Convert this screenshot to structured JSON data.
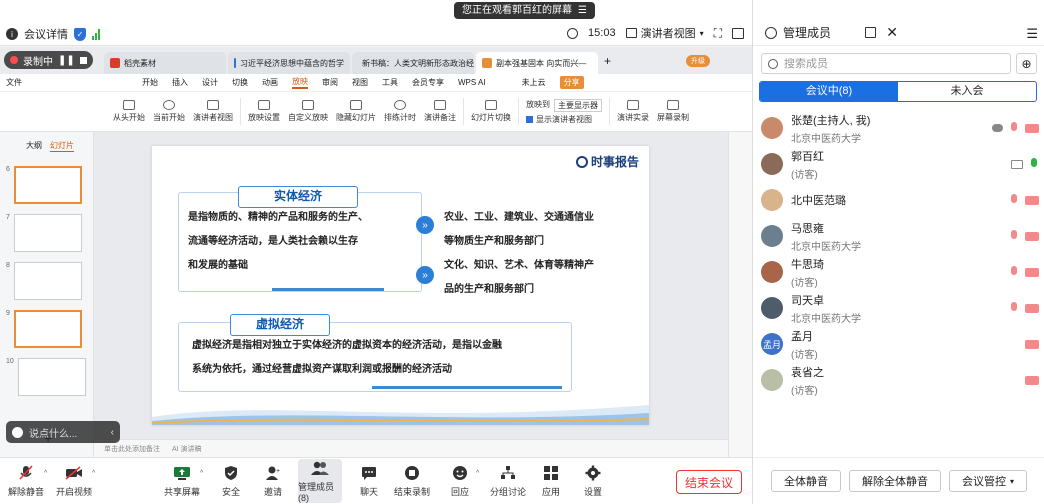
{
  "banner": {
    "text": "您正在观看郭百红的屏幕",
    "icon": "hamburger-icon"
  },
  "topbar": {
    "meeting_details": "会议详情",
    "time": "15:03",
    "view_mode": "演讲者视图"
  },
  "recording": {
    "label": "录制中"
  },
  "browser_tabs": [
    {
      "label": "稻壳素材",
      "color": "#e0392d"
    },
    {
      "label": "习近平经济思想中蕴含的哲学",
      "color": "#2f6fd6"
    },
    {
      "label": "新书稿：人类文明新形态政治经",
      "color": "#2f6fd6"
    },
    {
      "label": "副本强基固本 向实而兴—",
      "color": "#e68e3a"
    }
  ],
  "wps_menu": [
    "文件",
    "开始",
    "插入",
    "设计",
    "切换",
    "动画",
    "放映",
    "审阅",
    "视图",
    "工具",
    "会员专享",
    "WPS AI",
    "未上云",
    "分享"
  ],
  "wps_upgrade": "升级",
  "ribbon": [
    "从头开始",
    "当前开始",
    "演讲者视图",
    "放映设置",
    "自定义放映",
    "隐藏幻灯片",
    "排练计时",
    "演讲备注",
    "幻灯片切换",
    "放映到",
    "主要显示器",
    "显示演讲者视图",
    "演讲实录",
    "屏幕录制"
  ],
  "outline": {
    "tab_outline": "大纲",
    "tab_slides": "幻灯片",
    "slide_numbers": [
      "6",
      "7",
      "8",
      "9",
      "10"
    ],
    "add": "+"
  },
  "comment_box": {
    "placeholder": "说点什么..."
  },
  "slide": {
    "logo": "时事报告",
    "real_title": "实体经济",
    "real_def_lines": [
      "是指物质的、精神的产品和服务的生产、",
      "流通等经济活动，是人类社会赖以生存",
      "和发展的基础"
    ],
    "real_items": [
      [
        "农业、工业、建筑业、交通通信业",
        "等物质生产和服务部门"
      ],
      [
        "文化、知识、艺术、体育等精神产",
        "品的生产和服务部门"
      ]
    ],
    "virtual_title": "虚拟经济",
    "virtual_lines": [
      "虚拟经济是指相对独立于实体经济的虚拟资本的经济活动，是指以金融",
      "系统为依托，通过经营虚拟资产谋取利润或报酬的经济活动"
    ]
  },
  "notes": {
    "placeholder": "单击此处添加备注",
    "ai": "AI 演讲稿"
  },
  "panel": {
    "title": "管理成员",
    "search_placeholder": "搜索成员",
    "tab_in": "会议中(8)",
    "tab_out": "未入会",
    "members": [
      {
        "name": "张楚(主持人, 我)",
        "sub": "北京中医药大学",
        "avatar_color": "#c98a6a",
        "mic": "off",
        "screen": false,
        "extra": "cloud"
      },
      {
        "name": "郭百红",
        "sub": "(访客)",
        "avatar_color": "#8a6b5a",
        "mic": "on",
        "screen": true
      },
      {
        "name": "北中医范璐",
        "sub": "",
        "avatar_color": "#d9b38c",
        "mic": "off",
        "screen": false
      },
      {
        "name": "马思雍",
        "sub": "北京中医药大学",
        "avatar_color": "#6c7f8e",
        "mic": "off",
        "screen": false
      },
      {
        "name": "牛思琦",
        "sub": "(访客)",
        "avatar_color": "#a8654a",
        "mic": "off",
        "screen": false
      },
      {
        "name": "司天卓",
        "sub": "北京中医药大学",
        "avatar_color": "#4f5d6b",
        "mic": "off",
        "screen": false
      },
      {
        "name": "孟月",
        "sub": "(访客)",
        "avatar_color": "#3f72c9",
        "avatar_text": "孟月",
        "mic": "none",
        "screen": false
      },
      {
        "name": "袁省之",
        "sub": "(访客)",
        "avatar_color": "#b9bfa6",
        "mic": "none",
        "screen": false
      }
    ],
    "buttons": {
      "mute_all": "全体静音",
      "unmute_all": "解除全体静音",
      "control": "会议管控"
    }
  },
  "toolbar": [
    {
      "label": "解除静音",
      "icon": "mic-muted-icon"
    },
    {
      "label": "开启视频",
      "icon": "camera-off-icon"
    },
    {
      "label": "共享屏幕",
      "icon": "share-screen-icon"
    },
    {
      "label": "安全",
      "icon": "shield-icon"
    },
    {
      "label": "邀请",
      "icon": "invite-icon"
    },
    {
      "label": "管理成员(8)",
      "icon": "members-icon"
    },
    {
      "label": "聊天",
      "icon": "chat-icon"
    },
    {
      "label": "结束录制",
      "icon": "stop-record-icon"
    },
    {
      "label": "回应",
      "icon": "reaction-icon"
    },
    {
      "label": "分组讨论",
      "icon": "breakout-icon"
    },
    {
      "label": "应用",
      "icon": "apps-icon"
    },
    {
      "label": "设置",
      "icon": "gear-icon"
    }
  ],
  "end_meeting": "结束会议"
}
